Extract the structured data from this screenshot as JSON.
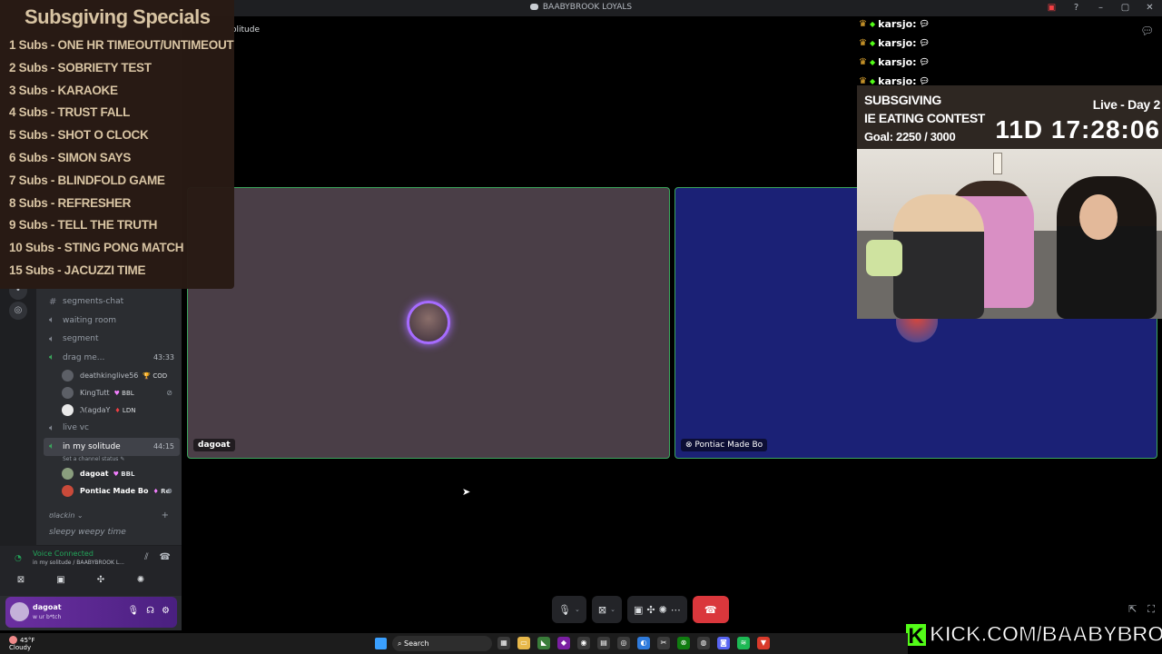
{
  "window": {
    "title": "BAABYBROOK LOYALS",
    "stage_title": "olitude"
  },
  "specials": {
    "title": "Subsgiving Specials",
    "items": [
      "1 Subs - ONE HR TIMEOUT/UNTIMEOUT",
      "2 Subs - SOBRIETY TEST",
      "3 Subs - KARAOKE",
      "4 Subs - TRUST FALL",
      "5 Subs - SHOT O CLOCK",
      "6 Subs - SIMON SAYS",
      "7 Subs - BLINDFOLD GAME",
      "8 Subs - REFRESHER",
      "9 Subs - TELL THE TRUTH",
      "10 Subs - STING PONG MATCH",
      "15 Subs - JACUZZI TIME"
    ]
  },
  "chat": {
    "lines": [
      {
        "user": "karsjo:"
      },
      {
        "user": "karsjo:"
      },
      {
        "user": "karsjo:"
      },
      {
        "user": "karsjo:"
      }
    ]
  },
  "subathon": {
    "title": "SUBSGIVING",
    "event": "IE EATING CONTEST",
    "goal": "Goal: 2250 / 3000",
    "live": "Live - Day 2",
    "timer": "11D 17:28:06"
  },
  "channels": [
    {
      "type": "text",
      "name": "segments-chat"
    },
    {
      "type": "voice",
      "name": "waiting room"
    },
    {
      "type": "voice",
      "name": "segment"
    },
    {
      "type": "voice",
      "name": "drag me...",
      "timer": "43:33",
      "users": [
        {
          "name": "deathkinglive56",
          "tag": "COD",
          "tag_icon": "🏆"
        },
        {
          "name": "KingTutt",
          "tag": "BBL",
          "tag_icon": "♥"
        },
        {
          "name": "ℳagdaY",
          "tag": "LDN",
          "tag_icon": "♦"
        }
      ]
    },
    {
      "type": "voice",
      "name": "live vc"
    },
    {
      "type": "voice",
      "name": "in my solitude",
      "timer": "44:15",
      "status": "Set a channel status ✎",
      "active": true,
      "users": [
        {
          "name": "dagoat",
          "tag": "BBL",
          "tag_icon": "♥",
          "bold": true
        },
        {
          "name": "Pontiac Made Bo",
          "tag": "Re",
          "tag_icon": "♦"
        }
      ]
    }
  ],
  "category": {
    "name": "ʊlackin",
    "next_channel": "sleepy weepy time"
  },
  "voice_panel": {
    "status": "Voice Connected",
    "location": "in my solitude / BAABYBROOK L..."
  },
  "user_panel": {
    "name": "dagoat",
    "status": "w ur b*tch"
  },
  "tiles": [
    {
      "name": "dagoat"
    },
    {
      "name": "Pontiac Made Bo"
    }
  ],
  "kick": {
    "logo": "K",
    "text": "KICK.COM/BAABYBROOK"
  },
  "taskbar": {
    "weather_temp": "45°F",
    "weather_desc": "Cloudy",
    "search_placeholder": "Search"
  },
  "colors": {
    "speaking_green": "#3ba55c",
    "leave_red": "#da373c",
    "kick_green": "#53fc18",
    "tile1_bg": "#4a3e47",
    "tile2_bg": "#1b2176"
  }
}
